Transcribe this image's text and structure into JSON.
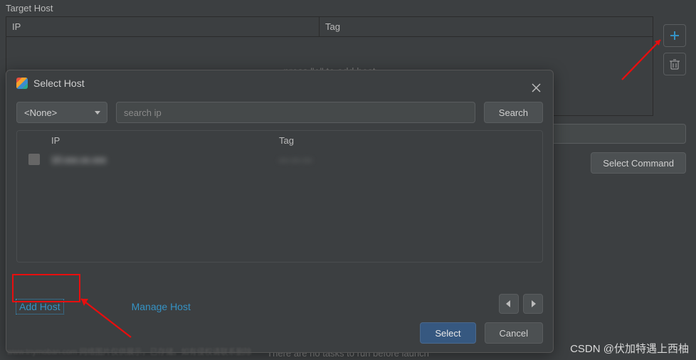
{
  "bg": {
    "section_label": "Target Host",
    "cols": {
      "ip": "IP",
      "tag": "Tag"
    },
    "empty_hint": "press \"+\" to add host",
    "select_command": "Select Command",
    "bottom_hint": "There are no tasks to run before launch"
  },
  "dlg": {
    "title": "Select Host",
    "filter_value": "<None>",
    "search_placeholder": "search ip",
    "search_btn": "Search",
    "cols": {
      "ip": "IP",
      "tag": "Tag"
    },
    "row": {
      "ip": "10.xxx.xx.xxx",
      "tag": "— — —"
    },
    "add_host": "Add Host",
    "manage_host": "Manage Host",
    "select_btn": "Select",
    "cancel_btn": "Cancel"
  },
  "watermark": "CSDN @伏加特遇上西柚",
  "wm2": "www.tnymoban.com 网络图片仅供展示，已存储。如有侵权请联系删除"
}
